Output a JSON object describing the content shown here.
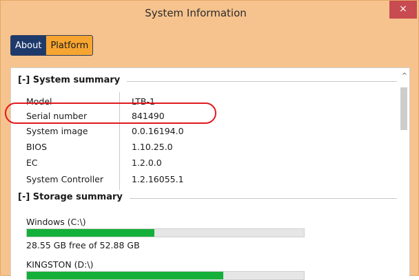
{
  "window": {
    "title": "System Information",
    "close_glyph": "×"
  },
  "tabs": [
    {
      "label": "About",
      "active": true
    },
    {
      "label": "Platform",
      "active": false
    }
  ],
  "system_summary": {
    "header": "[-] System summary",
    "rows": [
      {
        "label": "Model",
        "value": "LTB-1"
      },
      {
        "label": "Serial number",
        "value": "841490"
      },
      {
        "label": "System image",
        "value": "0.0.16194.0"
      },
      {
        "label": "BIOS",
        "value": "1.10.25.0"
      },
      {
        "label": "EC",
        "value": "1.2.0.0"
      },
      {
        "label": "System Controller",
        "value": "1.2.16055.1"
      }
    ]
  },
  "storage_summary": {
    "header": "[-] Storage summary",
    "drives": [
      {
        "name": "Windows (C:\\)",
        "free_text": "28.55 GB free of 52.88 GB",
        "used_fraction": 0.46
      },
      {
        "name": "KINGSTON (D:\\)",
        "free_text": "",
        "used_fraction": 0.71
      }
    ]
  },
  "scrollbar": {
    "up_glyph": "^"
  },
  "colors": {
    "accent": "#f6c38e",
    "about_tab": "#1e3a6b",
    "platform_tab": "#f7a531",
    "storage_fill": "#14b03a",
    "highlight": "#e0191e",
    "close": "#c74b50"
  }
}
